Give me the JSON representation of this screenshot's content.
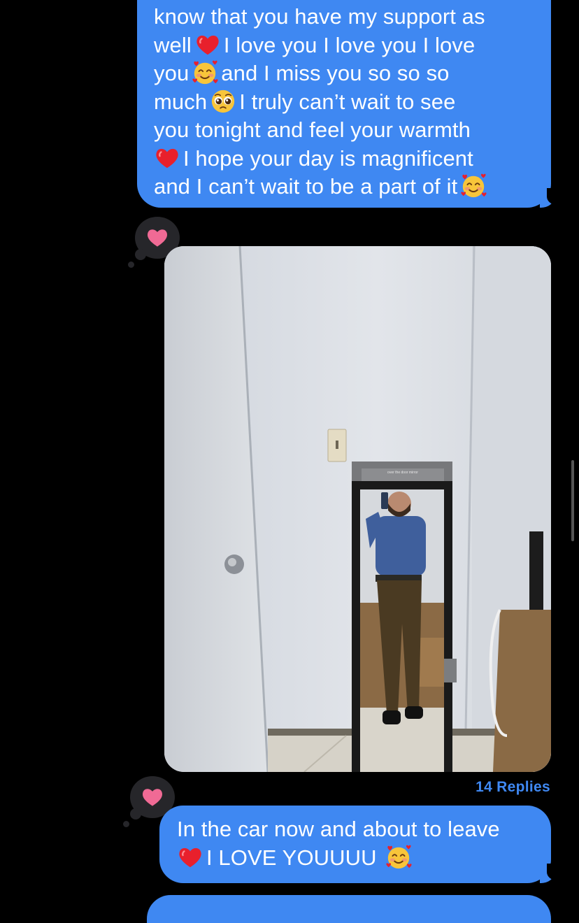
{
  "messages": {
    "top": {
      "lines": [
        "know that you have my support as",
        [
          "well",
          "I love you I love you I love"
        ],
        [
          "you",
          "and I miss you so so so"
        ],
        [
          "much",
          "I truly can’t wait to see"
        ],
        "you tonight and feel your warmth",
        [
          "",
          "I hope your day is magnificent"
        ],
        [
          "and I can’t wait to be a part of it",
          ""
        ]
      ]
    },
    "photo": {
      "mirror_label": "over the door mirror",
      "replies": "14 Replies"
    },
    "bottom": {
      "line1": "In the car now and about to leave",
      "line2": "I LOVE YOUUUU"
    }
  },
  "reactions": {
    "photo": "heart",
    "bottom": "heart"
  },
  "icons": {
    "heart": "heart-icon",
    "smiling_face_hearts": "smiling-face-with-hearts-emoji",
    "red_heart": "red-heart-emoji",
    "pleading_face": "pleading-face-emoji"
  },
  "colors": {
    "bubble": "#3f88f2",
    "background": "#000000",
    "tapback": "#26262a",
    "heart": "#f06a95"
  }
}
